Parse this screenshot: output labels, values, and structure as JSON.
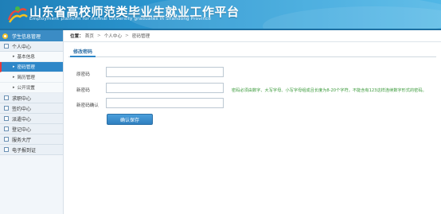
{
  "header": {
    "title": "山东省高校师范类毕业生就业工作平台",
    "subtitle": "Employment platform for normal university graduates in Shandong Province"
  },
  "sidebar": {
    "section_title": "学生信息管理",
    "groups": [
      {
        "label": "个人中心",
        "items": [
          {
            "label": "基本信息"
          },
          {
            "label": "密码管理",
            "active": true
          },
          {
            "label": "简历管理"
          },
          {
            "label": "公开设置"
          }
        ]
      },
      {
        "label": "求职中心"
      },
      {
        "label": "签约中心"
      },
      {
        "label": "派遣中心"
      },
      {
        "label": "登记中心"
      },
      {
        "label": "服务大厅"
      },
      {
        "label": "电子报到证"
      }
    ]
  },
  "breadcrumb": {
    "label": "位置：",
    "items": [
      "首页",
      "个人中心",
      "密码管理"
    ]
  },
  "form": {
    "tab": "修改密码",
    "fields": [
      {
        "label": "原密码",
        "value": ""
      },
      {
        "label": "新密码",
        "value": ""
      },
      {
        "label": "新密码确认",
        "value": ""
      }
    ],
    "hint": "密码必须由数字、大写字母、小写字母组成且长度为8-20个字符，不能含有123这样连续数字形式的密码。",
    "submit": "确认保存"
  }
}
